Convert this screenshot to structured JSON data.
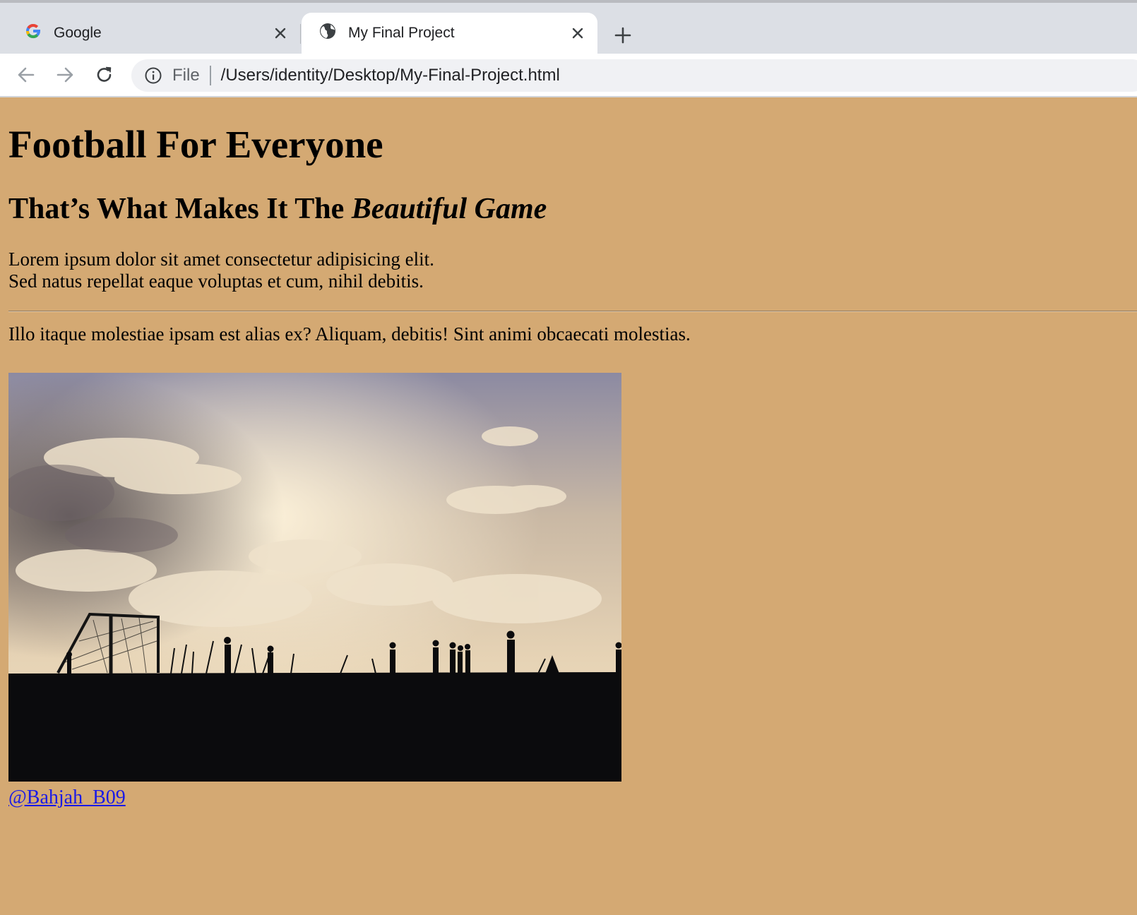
{
  "browser": {
    "tabs": [
      {
        "title": "Google",
        "icon": "google-icon",
        "active": false
      },
      {
        "title": "My Final Project",
        "icon": "globe-icon",
        "active": true
      }
    ],
    "address_bar": {
      "security_label": "File",
      "url": "/Users/identity/Desktop/My-Final-Project.html"
    }
  },
  "page": {
    "background_color": "#d4a973",
    "heading": "Football For Everyone",
    "subheading_plain": "That’s What Makes It The ",
    "subheading_italic": "Beautiful Game",
    "paragraph1_line1": "Lorem ipsum dolor sit amet consectetur adipisicing elit.",
    "paragraph1_line2": "Sed natus repellat eaque voluptas et cum, nihil debitis.",
    "paragraph2": "Illo itaque molestiae ipsam est alias ex? Aliquam, debitis! Sint animi obcaecati molestias.",
    "image": {
      "subject": "silhouettes of football players and a goal under a cloudy sunset sky"
    },
    "credit_link": "@Bahjah_B09"
  }
}
